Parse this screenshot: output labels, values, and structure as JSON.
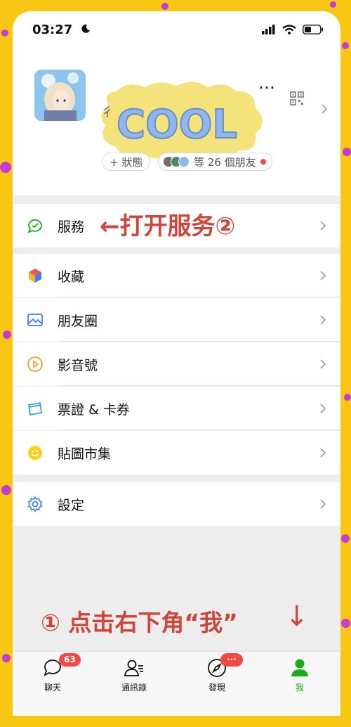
{
  "status_bar": {
    "time": "03:27"
  },
  "profile": {
    "sticker_text": "COOL",
    "name_suffix": "…",
    "wxid_prefix": "彳",
    "status_button": "+ 狀態",
    "friends_text": "等 26 個朋友"
  },
  "menu": {
    "services": "服務",
    "favorites": "收藏",
    "moments": "朋友圈",
    "channels": "影音號",
    "cards": "票證 & 卡券",
    "stickers": "貼圖市集",
    "settings": "設定"
  },
  "annotations": {
    "open_services": "←打开服务②",
    "tap_me": "① 点击右下角“我”",
    "down_arrow": "↓"
  },
  "tabbar": {
    "chats": "聊天",
    "chats_badge": "63",
    "contacts": "通訊錄",
    "discover": "發現",
    "discover_badge": "···",
    "me": "我"
  },
  "colors": {
    "background": "#f7c713",
    "accent_green": "#1aad19",
    "annotation_red": "#d0453a",
    "badge_red": "#f24a42"
  }
}
